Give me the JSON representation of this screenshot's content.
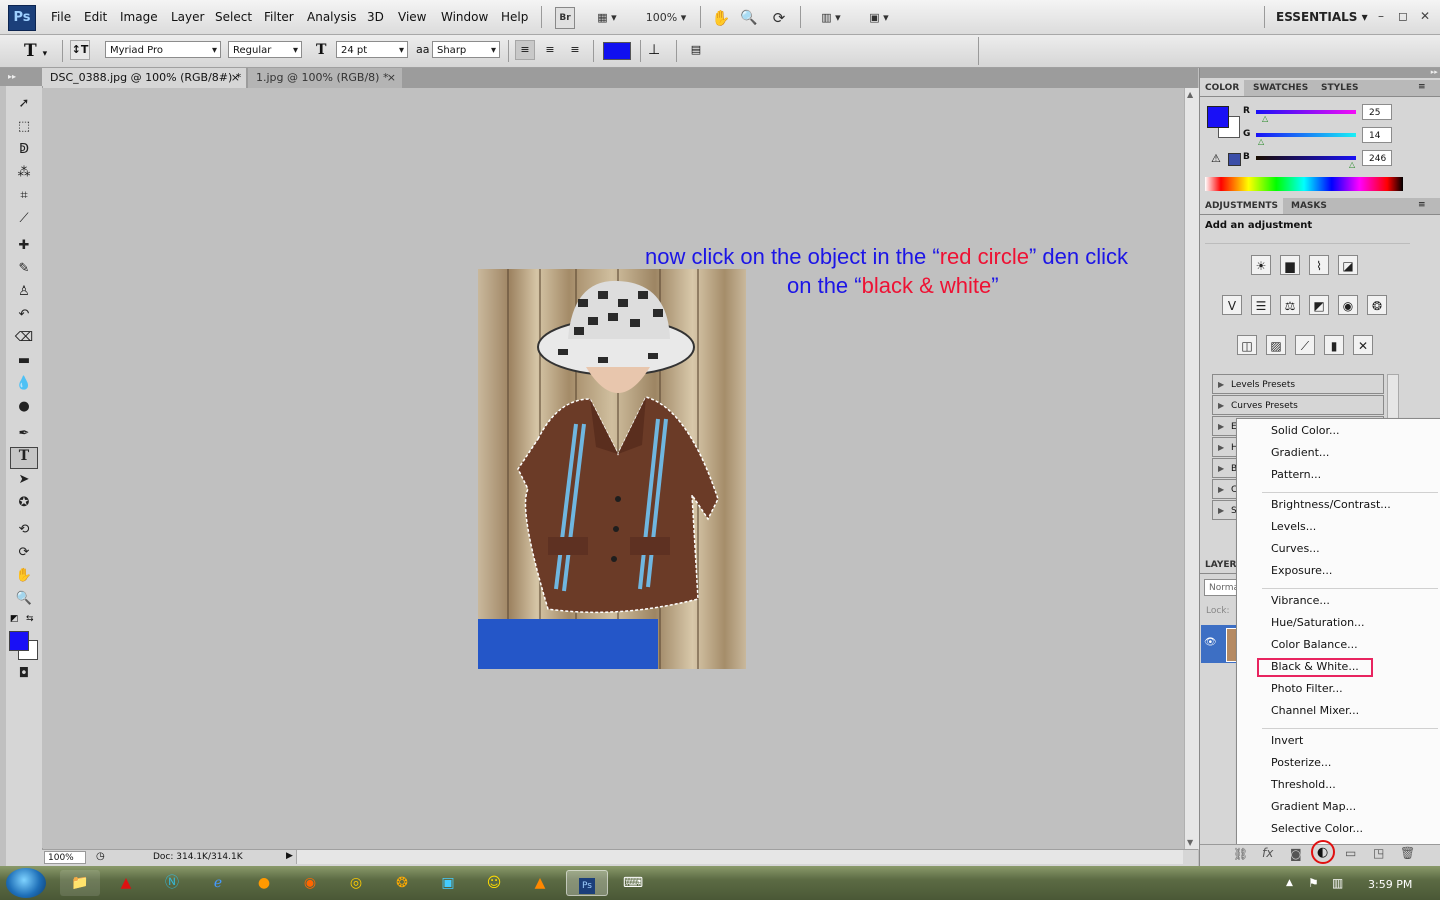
{
  "menubar": {
    "logo": "Ps",
    "items": [
      "File",
      "Edit",
      "Image",
      "Layer",
      "Select",
      "Filter",
      "Analysis",
      "3D",
      "View",
      "Window",
      "Help"
    ],
    "bridge_label": "Br",
    "zoom": "100%",
    "workspace": "ESSENTIALS",
    "window_controls": [
      "–",
      "◻",
      "✕"
    ]
  },
  "options": {
    "tool_glyph": "T",
    "font_family": "Myriad Pro",
    "font_style": "Regular",
    "font_size": "24 pt",
    "aa_label": "aa",
    "antialias": "Sharp",
    "text_color": "#1010f0"
  },
  "tabs": [
    {
      "label": "DSC_0388.jpg @ 100% (RGB/8#) *",
      "close": "×"
    },
    {
      "label": "1.jpg @ 100% (RGB/8) *",
      "close": "×"
    }
  ],
  "instruction": {
    "line1_a": "now click on the object in the “",
    "line1_b": "red circle",
    "line1_c": "”  den click",
    "line2_a": "on the “",
    "line2_b": "black & white",
    "line2_c": "”"
  },
  "statusbar": {
    "zoom": "100%",
    "doc": "Doc: 314.1K/314.1K"
  },
  "color_panel": {
    "tabs": [
      "COLOR",
      "SWATCHES",
      "STYLES"
    ],
    "channels": [
      {
        "label": "R",
        "value": "25",
        "fraction": 0.098
      },
      {
        "label": "G",
        "value": "14",
        "fraction": 0.055
      },
      {
        "label": "B",
        "value": "246",
        "fraction": 0.965
      }
    ],
    "foreground": "#1910f6",
    "background": "#ffffff"
  },
  "adjustments_panel": {
    "tabs": [
      "ADJUSTMENTS",
      "MASKS"
    ],
    "heading": "Add an adjustment",
    "presets": [
      "Levels Presets",
      "Curves Presets"
    ],
    "partial_presets": [
      "E",
      "H",
      "B",
      "C",
      "S"
    ]
  },
  "layers_panel": {
    "tab": "LAYER",
    "blend": "Norma",
    "lock": "Lock:"
  },
  "adjustment_menu": {
    "groups": [
      [
        "Solid Color...",
        "Gradient...",
        "Pattern..."
      ],
      [
        "Brightness/Contrast...",
        "Levels...",
        "Curves...",
        "Exposure..."
      ],
      [
        "Vibrance...",
        "Hue/Saturation...",
        "Color Balance...",
        "Black & White...",
        "Photo Filter...",
        "Channel Mixer..."
      ],
      [
        "Invert",
        "Posterize...",
        "Threshold...",
        "Gradient Map...",
        "Selective Color..."
      ]
    ],
    "highlighted": "Black & White...",
    "highlight_color": "#e8245f"
  },
  "taskbar": {
    "clock": "3:59 PM"
  }
}
